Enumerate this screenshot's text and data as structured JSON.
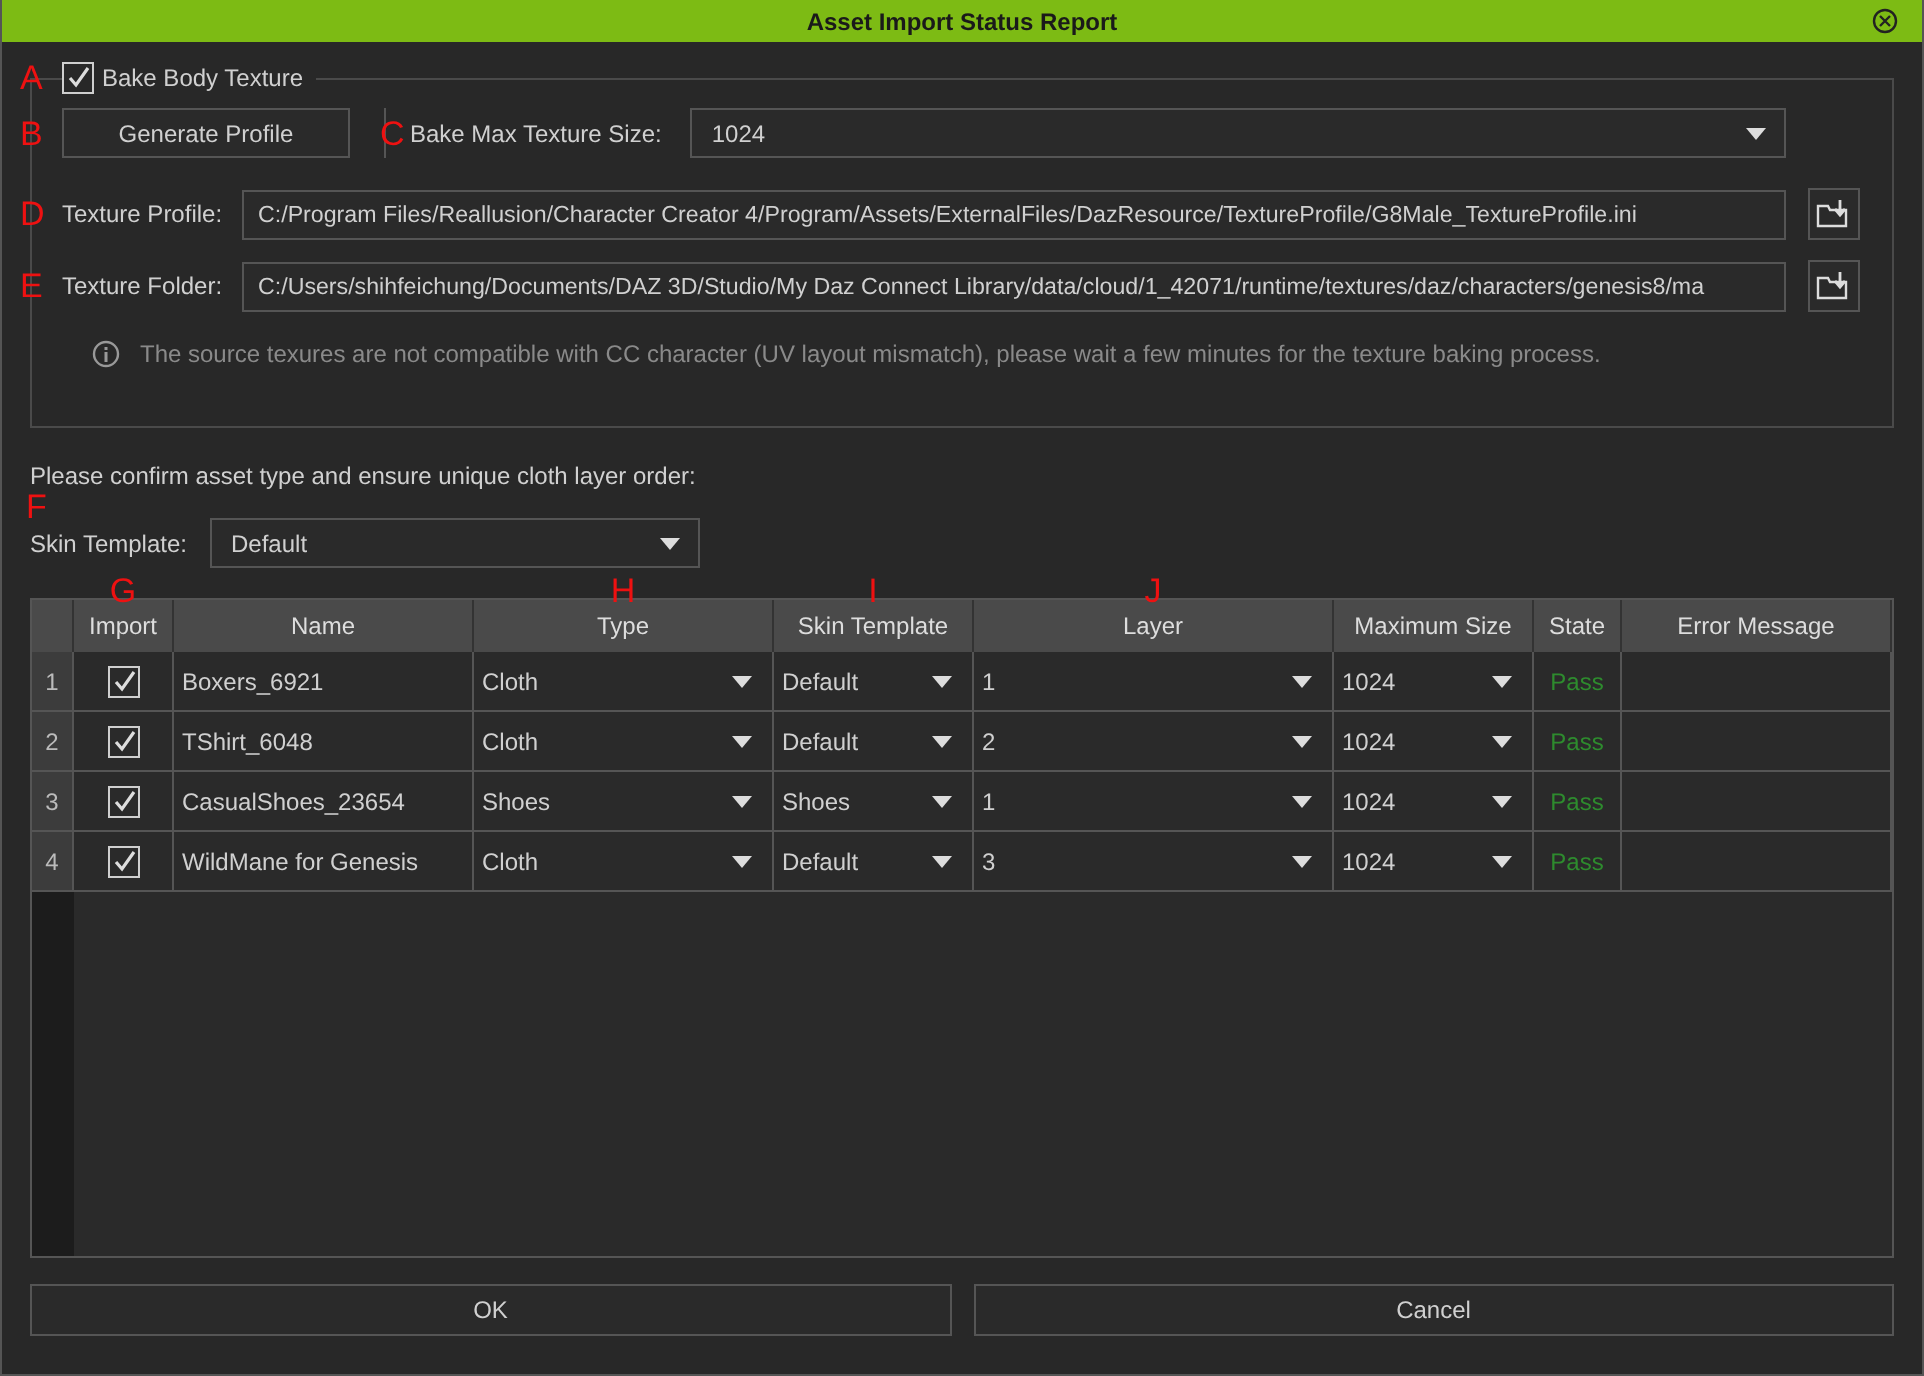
{
  "window": {
    "title": "Asset Import Status Report"
  },
  "bake": {
    "callout": "A",
    "label": "Bake Body Texture",
    "checked": true,
    "generate": {
      "callout": "B",
      "label": "Generate Profile"
    },
    "max_size": {
      "callout": "C",
      "label": "Bake Max Texture Size:",
      "value": "1024"
    },
    "profile": {
      "callout": "D",
      "label": "Texture Profile:",
      "value": "C:/Program Files/Reallusion/Character Creator 4/Program/Assets/ExternalFiles/DazResource/TextureProfile/G8Male_TextureProfile.ini"
    },
    "folder": {
      "callout": "E",
      "label": "Texture Folder:",
      "value": "C:/Users/shihfeichung/Documents/DAZ 3D/Studio/My Daz Connect Library/data/cloud/1_42071/runtime/textures/daz/characters/genesis8/ma"
    },
    "info": "The source texures are not compatible with CC character (UV layout mismatch), please wait a few minutes for the texture baking process."
  },
  "instruction": "Please confirm asset type and ensure unique cloth layer order:",
  "skin_template": {
    "callout": "F",
    "label": "Skin Template:",
    "value": "Default"
  },
  "table": {
    "columns": [
      {
        "label": "Import",
        "callout": "G"
      },
      {
        "label": "Name"
      },
      {
        "label": "Type",
        "callout": "H"
      },
      {
        "label": "Skin Template",
        "callout": "I"
      },
      {
        "label": "Layer",
        "callout": "J"
      },
      {
        "label": "Maximum Size"
      },
      {
        "label": "State"
      },
      {
        "label": "Error Message"
      }
    ],
    "rows": [
      {
        "number": "1",
        "import": true,
        "name": "Boxers_6921",
        "type": "Cloth",
        "skin": "Default",
        "layer": "1",
        "max_size": "1024",
        "state": "Pass"
      },
      {
        "number": "2",
        "import": true,
        "name": "TShirt_6048",
        "type": "Cloth",
        "skin": "Default",
        "layer": "2",
        "max_size": "1024",
        "state": "Pass"
      },
      {
        "number": "3",
        "import": true,
        "name": "CasualShoes_23654",
        "type": "Shoes",
        "skin": "Shoes",
        "layer": "1",
        "max_size": "1024",
        "state": "Pass"
      },
      {
        "number": "4",
        "import": true,
        "name": "WildMane for Genesis",
        "type": "Cloth",
        "skin": "Default",
        "layer": "3",
        "max_size": "1024",
        "state": "Pass"
      }
    ]
  },
  "buttons": [
    "OK",
    "Cancel"
  ]
}
